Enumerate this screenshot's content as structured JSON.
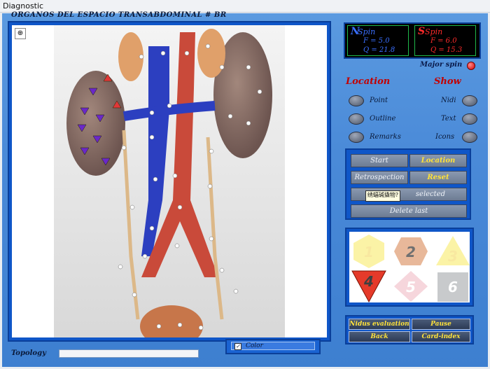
{
  "window": {
    "title": "Diagnostic"
  },
  "image": {
    "title": "ORGANOS DEL ESPACIO TRANSABDOMINAL # BR",
    "zoom_icon": "zoom-in-icon"
  },
  "spin": {
    "n_label": "N",
    "n_spin": "Spin",
    "n_f": "F = 5.0",
    "n_q": "Q = 21.8",
    "s_label": "S",
    "s_spin": "Spin",
    "s_f": "F = 6.0",
    "s_q": "Q = 15.3",
    "major": "Major spin"
  },
  "location": {
    "title": "Location",
    "point": "Point",
    "outline": "Outline",
    "remarks": "Remarks"
  },
  "show": {
    "title": "Show",
    "nidi": "Nidi",
    "text": "Text",
    "icons": "Icons"
  },
  "buttons": {
    "start": "Start",
    "location": "Location",
    "retrospection": "Retrospection",
    "reset": "Reset",
    "selected": "selected",
    "delete_last": "Delete last",
    "tooltip": "绣蝠碱撬物?"
  },
  "cards": [
    {
      "number": "1",
      "color": "#fbf3a6"
    },
    {
      "number": "2",
      "color": "#e8b89a"
    },
    {
      "number": "3",
      "color": "#fbf3a6"
    },
    {
      "number": "4",
      "color": "#e53a2a"
    },
    {
      "number": "5",
      "color": "#f6d6dc"
    },
    {
      "number": "6",
      "color": "#c8cacc"
    }
  ],
  "bottom": {
    "nidus": "Nidus evaluation",
    "pause": "Pause",
    "back": "Back",
    "card_index": "Card-index"
  },
  "topology": {
    "label": "Topology"
  },
  "color_toggle": {
    "label": "Color",
    "checked": "✓"
  }
}
